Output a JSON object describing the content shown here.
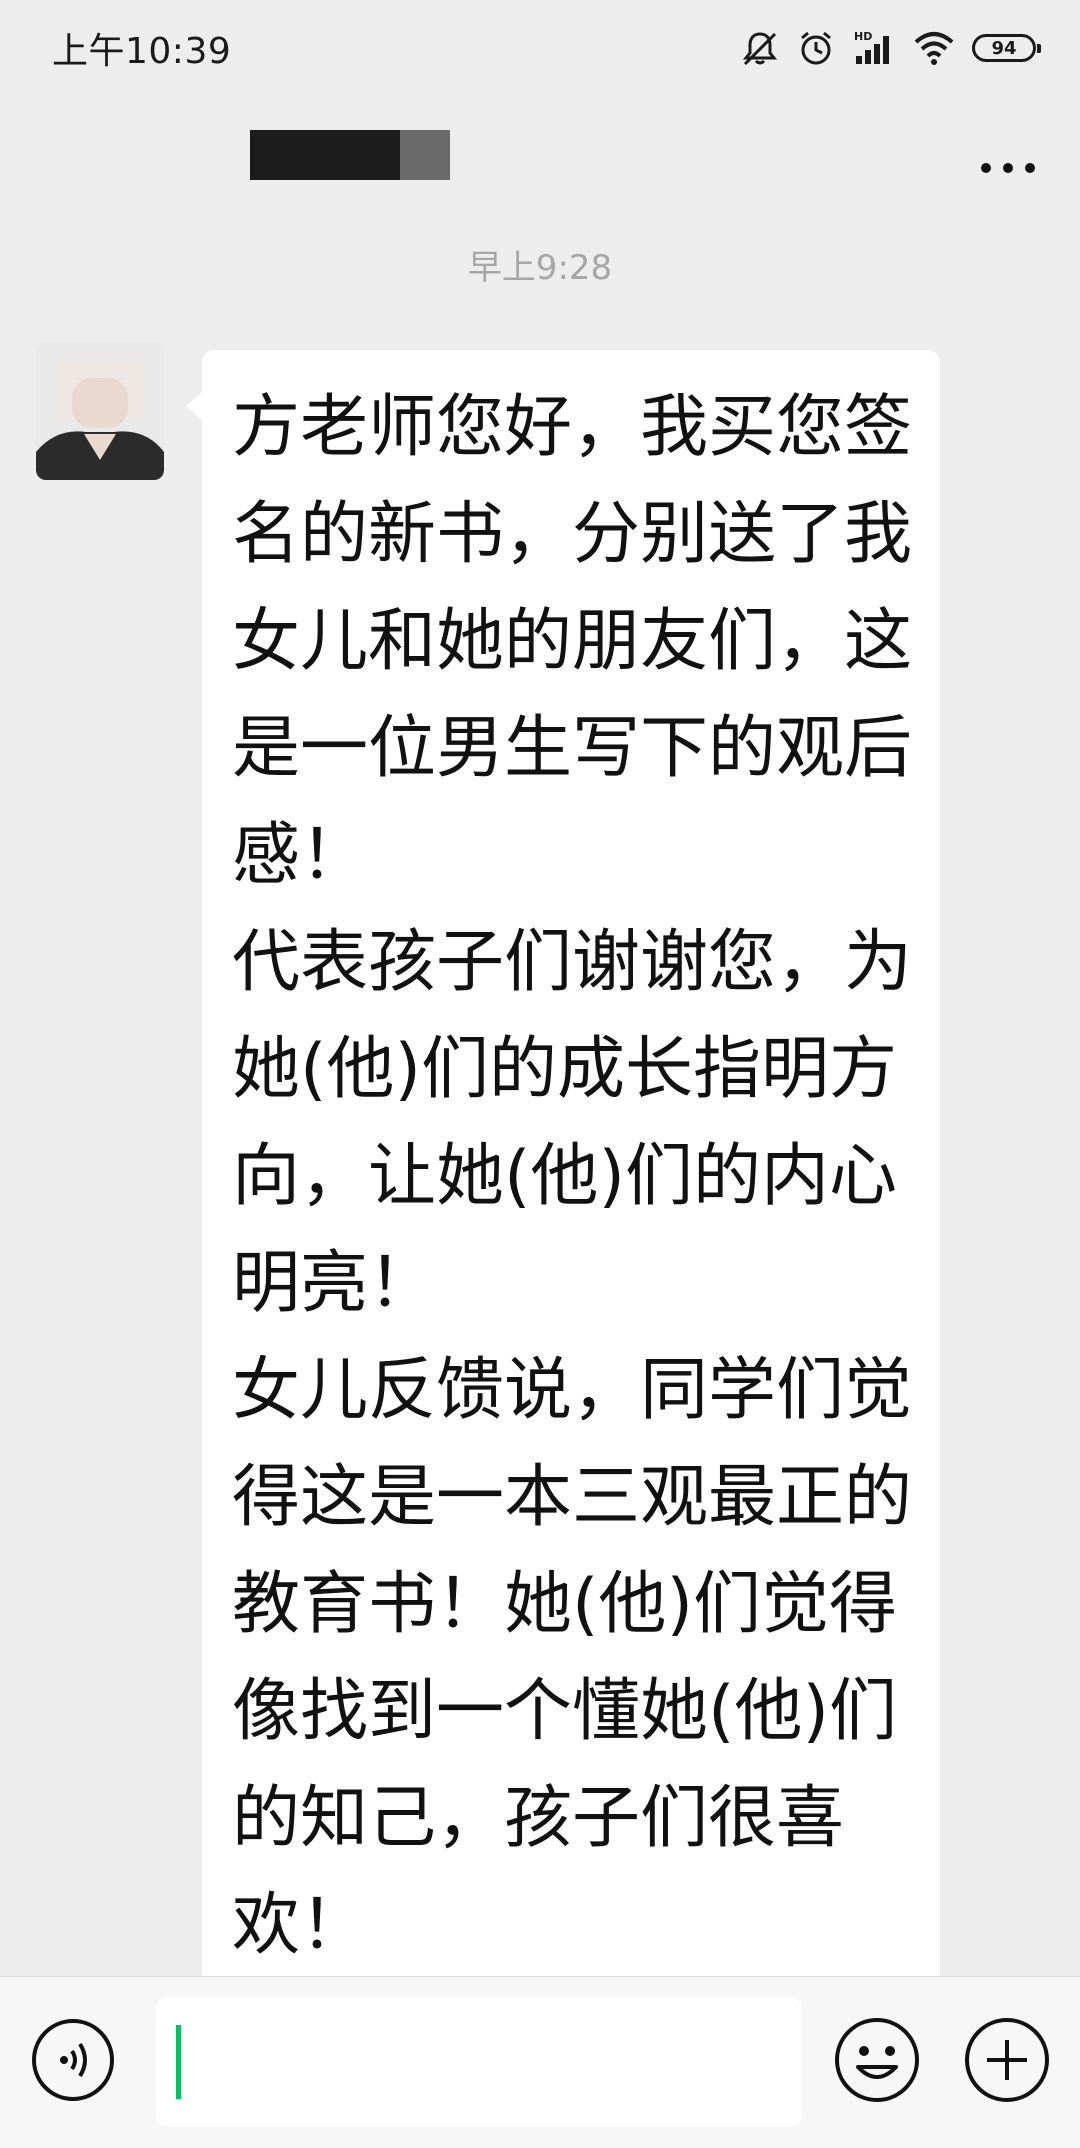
{
  "status_bar": {
    "time": "上午10:39",
    "battery_level": "94",
    "network_label": "HD",
    "icons": [
      "mute-icon",
      "alarm-icon",
      "hd-signal-icon",
      "wifi-icon",
      "battery-icon"
    ]
  },
  "title_bar": {
    "contact_name_redacted": true,
    "more_icon": "more-icon"
  },
  "chat": {
    "timestamp": "早上9:28",
    "messages": [
      {
        "sender": "contact",
        "text": "方老师您好，我买您签名的新书，分别送了我女儿和她的朋友们，这是一位男生写下的观后感！\n代表孩子们谢谢您，为她(他)们的成长指明方向，让她(他)们的内心明亮！\n女儿反馈说，同学们觉得这是一本三观最正的教育书！她(他)们觉得像找到一个懂她(他)们的知己，孩子们很喜欢！"
      }
    ]
  },
  "input_bar": {
    "voice_icon": "voice-icon",
    "input_value": "",
    "emoji_icon": "emoji-icon",
    "plus_icon": "plus-icon",
    "accent_color": "#07c160"
  }
}
